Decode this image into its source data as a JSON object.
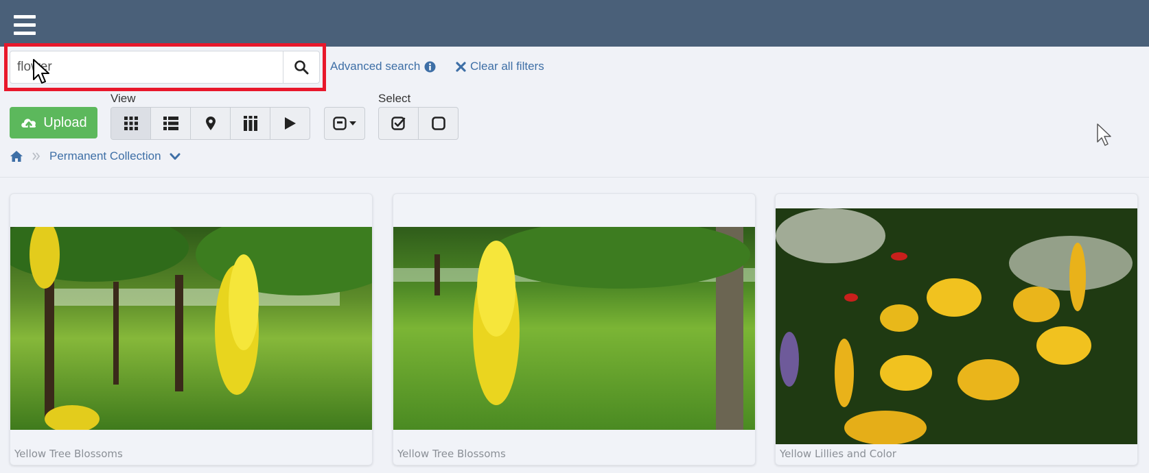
{
  "header": {
    "menu_icon": "hamburger-icon"
  },
  "search": {
    "value": "flower",
    "placeholder": "",
    "button_icon": "search-icon"
  },
  "links": {
    "advanced_search": "Advanced search",
    "clear_filters": "Clear all filters"
  },
  "toolbar": {
    "view_label": "View",
    "select_label": "Select",
    "upload_label": "Upload",
    "view_modes": [
      "grid-view-icon",
      "list-view-icon",
      "map-pin-icon",
      "columns-view-icon",
      "slideshow-play-icon"
    ],
    "active_view": "grid-view-icon"
  },
  "breadcrumb": {
    "home_icon": "home-icon",
    "collection": "Permanent Collection"
  },
  "results": [
    {
      "title": "Yellow Tree Blossoms"
    },
    {
      "title": "Yellow Tree Blossoms"
    },
    {
      "title": "Yellow Lillies and Color"
    }
  ],
  "colors": {
    "topbar": "#4a6079",
    "accent_link": "#3e6fa6",
    "upload_green": "#5cb85c",
    "highlight_red": "#e8182b"
  }
}
